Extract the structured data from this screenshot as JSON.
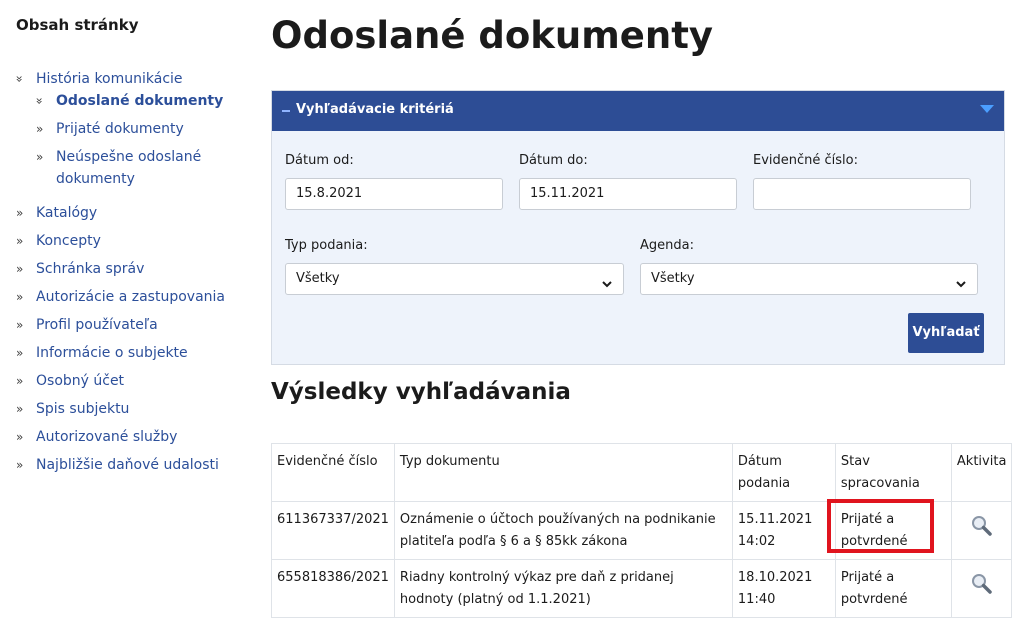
{
  "sidebar": {
    "title": "Obsah stránky",
    "items": [
      {
        "label": "História komunikácie",
        "expanded": true
      },
      {
        "label": "Odoslané dokumenty",
        "active": true,
        "expanded": true
      },
      {
        "label": "Prijaté dokumenty"
      },
      {
        "label": "Neúspešne odoslané",
        "label2": "dokumenty"
      },
      {
        "label": "Katalógy"
      },
      {
        "label": "Koncepty"
      },
      {
        "label": "Schránka správ"
      },
      {
        "label": "Autorizácie a zastupovania"
      },
      {
        "label": "Profil používateľa"
      },
      {
        "label": "Informácie o subjekte"
      },
      {
        "label": "Osobný účet"
      },
      {
        "label": "Spis subjektu"
      },
      {
        "label": "Autorizované služby"
      },
      {
        "label": "Najbližšie daňové udalosti"
      }
    ],
    "icons": {
      "expanded": "double-chevron-down-icon",
      "collapsed": "double-chevron-right-icon"
    }
  },
  "main": {
    "title": "Odoslané dokumenty",
    "criteria": {
      "header": "Vyhľadávacie kritériá",
      "date_from_label": "Dátum od:",
      "date_from_value": "15.8.2021",
      "date_to_label": "Dátum do:",
      "date_to_value": "15.11.2021",
      "evidence_label": "Evidenčné číslo:",
      "evidence_value": "",
      "type_label": "Typ podania:",
      "type_value": "Všetky",
      "agenda_label": "Agenda:",
      "agenda_value": "Všetky",
      "search_button": "Vyhľadať"
    },
    "results": {
      "title": "Výsledky vyhľadávania",
      "columns": [
        "Evidenčné číslo",
        "Typ dokumentu",
        "Dátum podania",
        "Stav spracovania",
        "Aktivita"
      ],
      "rows": [
        {
          "evidence": "611367337/2021",
          "type": "Oznámenie o účtoch používaných na podnikanie platiteľa podľa § 6 a § 85kk zákona",
          "date": "15.11.2021 14:02",
          "status": "Prijaté a potvrdené"
        },
        {
          "evidence": "655818386/2021",
          "type": "Riadny kontrolný výkaz pre daň z pridanej hodnoty (platný od 1.1.2021)",
          "date": "18.10.2021 11:40",
          "status": "Prijaté a potvrdené"
        }
      ]
    }
  },
  "colors": {
    "primary": "#2d4d95",
    "link": "#2c4f9a",
    "panel_bg": "#eef3fb",
    "highlight": "#e0141e"
  }
}
